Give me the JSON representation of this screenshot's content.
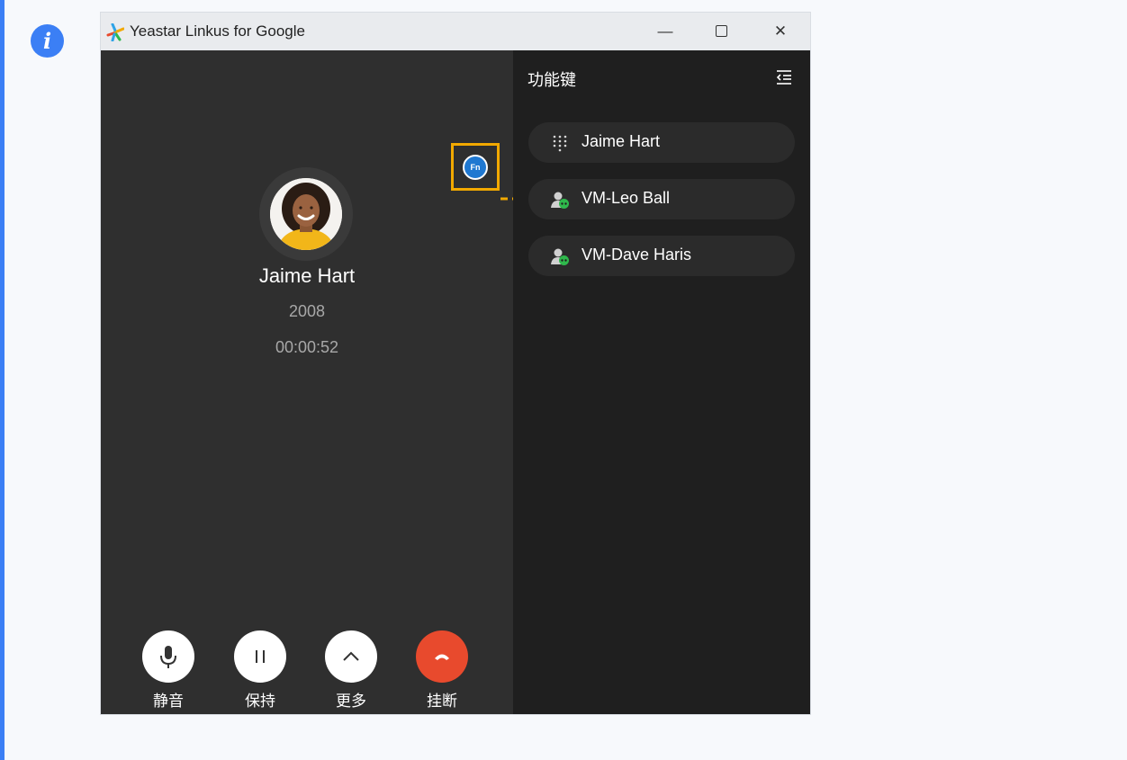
{
  "window": {
    "title": "Yeastar Linkus for Google",
    "controls": {
      "minimize": "—",
      "close": "✕"
    }
  },
  "call": {
    "caller_name": "Jaime Hart",
    "extension": "2008",
    "duration": "00:00:52",
    "fn_button_label": "Fn",
    "controls": [
      {
        "label": "静音",
        "icon": "microphone-icon"
      },
      {
        "label": "保持",
        "icon": "pause-icon"
      },
      {
        "label": "更多",
        "icon": "chevron-up-icon"
      },
      {
        "label": "挂断",
        "icon": "hang-up-icon",
        "color": "#e84a2d"
      }
    ]
  },
  "function_keys": {
    "title": "功能键",
    "items": [
      {
        "label": "Jaime Hart",
        "icon": "dialpad-icon"
      },
      {
        "label": "VM-Leo Ball",
        "icon": "contact-online-icon"
      },
      {
        "label": "VM-Dave Haris",
        "icon": "contact-online-icon"
      }
    ]
  },
  "colors": {
    "accent": "#3b7ff5",
    "highlight": "#f2a900",
    "hangup": "#e84a2d",
    "online": "#2fb84c"
  }
}
